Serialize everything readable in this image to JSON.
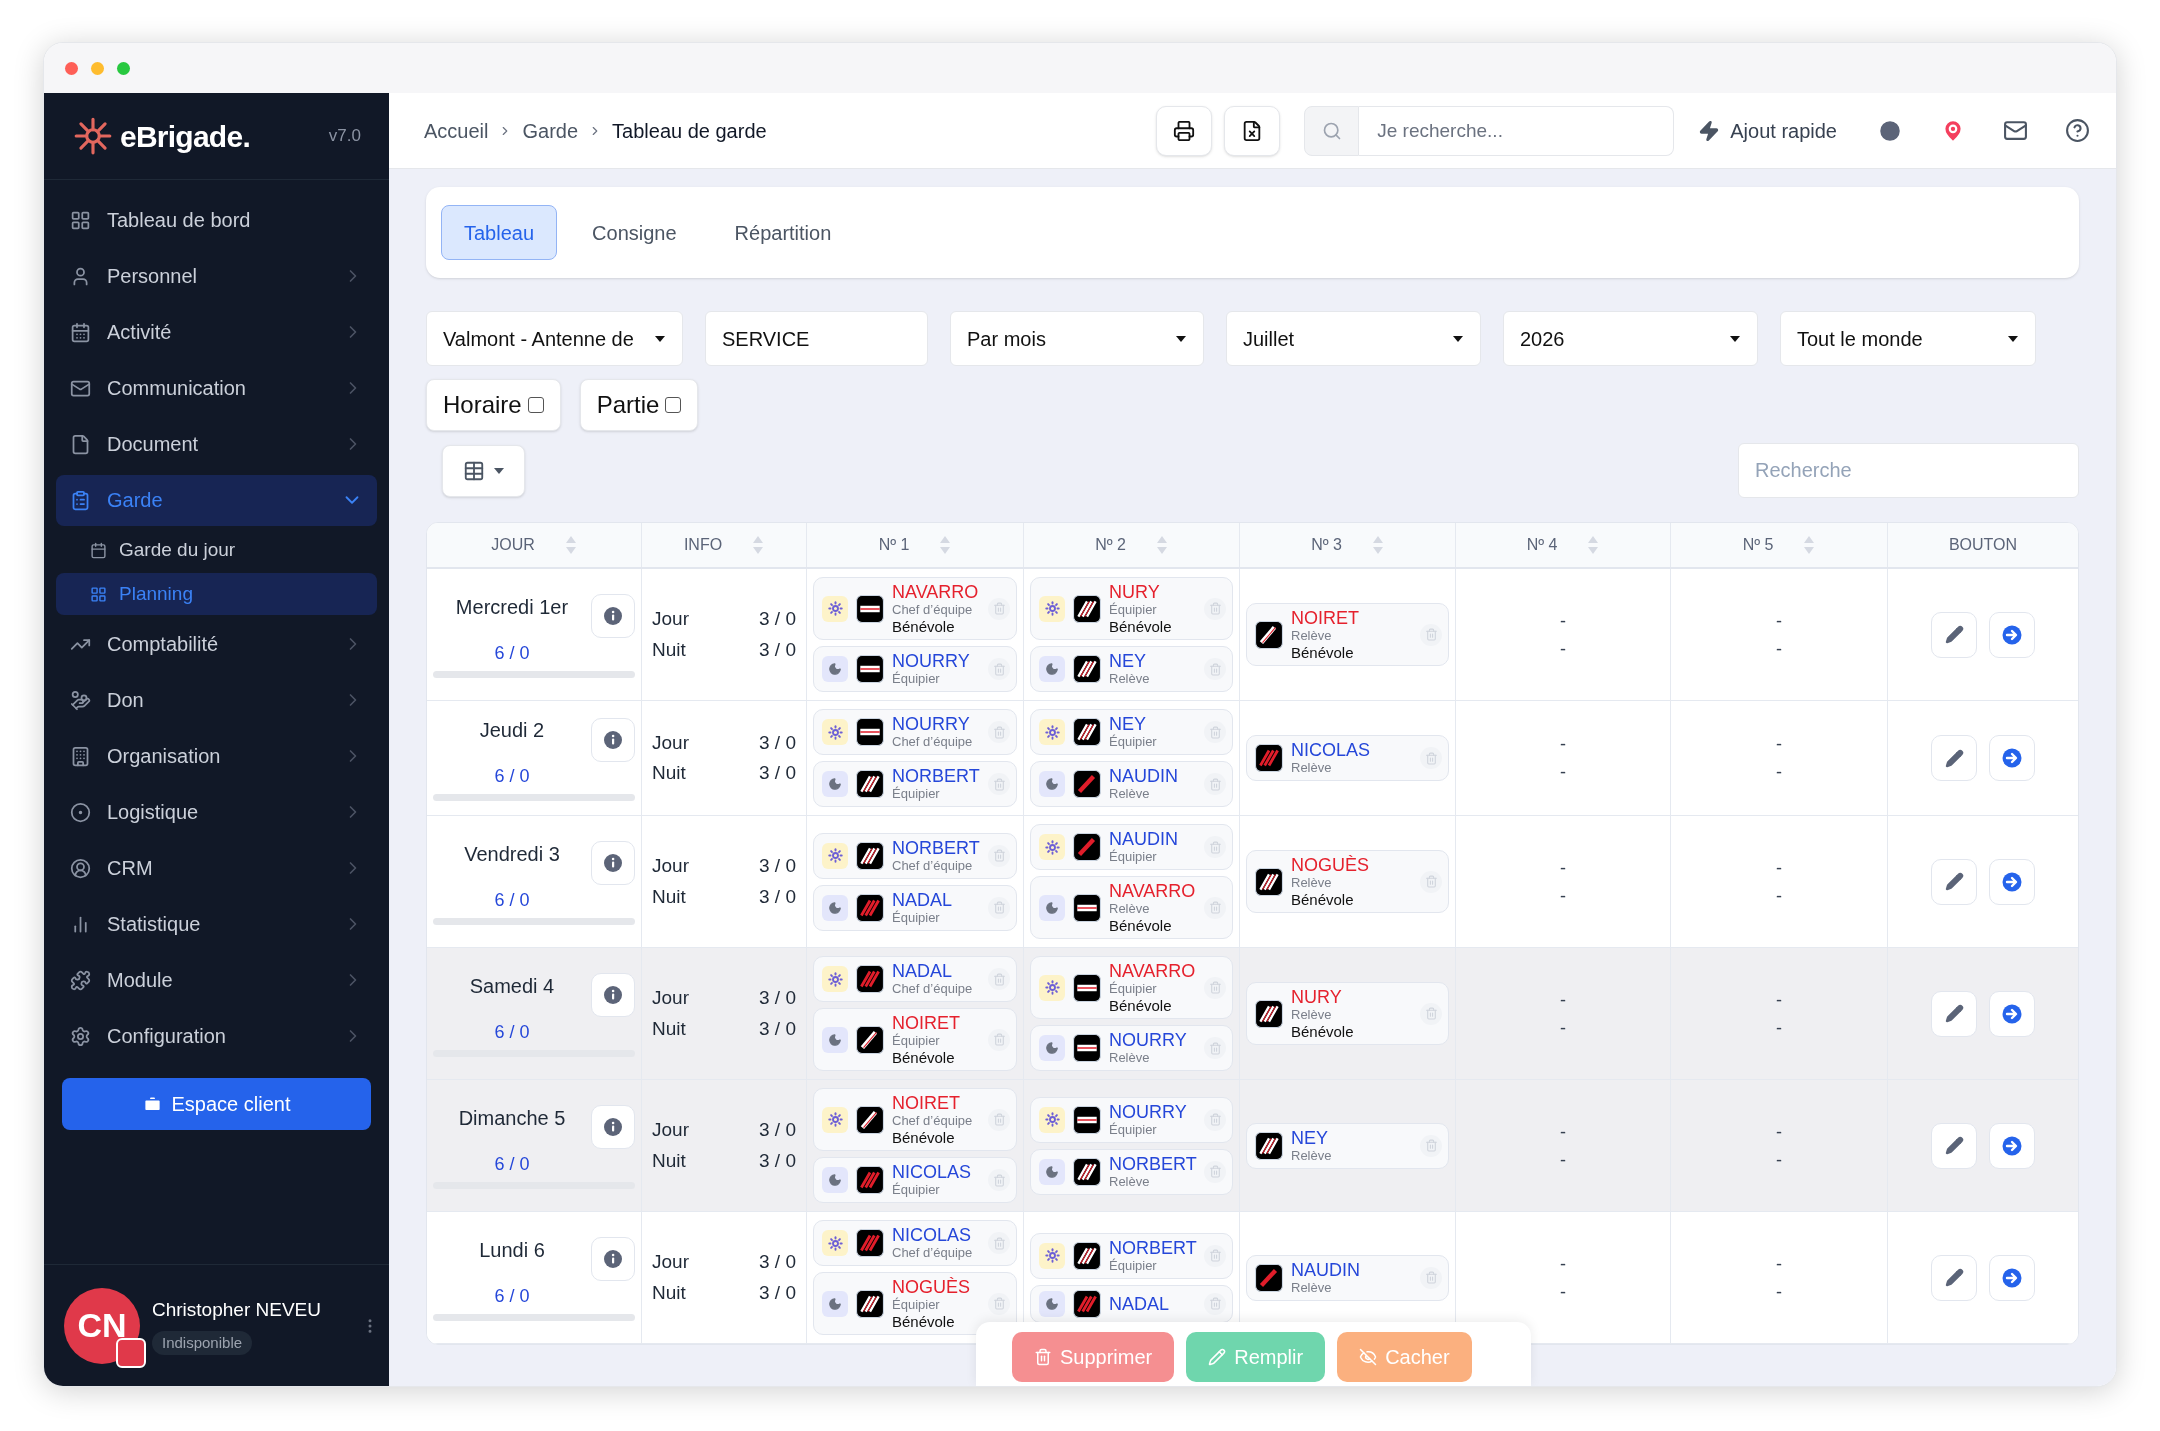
{
  "sidebar": {
    "logo": "eBrigade.",
    "version": "v7.0",
    "items": [
      {
        "label": "Tableau de bord",
        "selected": false
      },
      {
        "label": "Personnel",
        "selected": false,
        "expanded": false
      },
      {
        "label": "Activité",
        "selected": false,
        "expanded": false
      },
      {
        "label": "Communication",
        "selected": false,
        "expanded": false
      },
      {
        "label": "Document",
        "selected": false,
        "expanded": false
      },
      {
        "label": "Garde",
        "selected": true,
        "expanded": true,
        "children": [
          {
            "label": "Garde du jour",
            "selected": false
          },
          {
            "label": "Planning",
            "selected": true
          }
        ]
      },
      {
        "label": "Comptabilité",
        "selected": false,
        "expanded": false
      },
      {
        "label": "Don",
        "selected": false,
        "expanded": false
      },
      {
        "label": "Organisation",
        "selected": false,
        "expanded": false
      },
      {
        "label": "Logistique",
        "selected": false,
        "expanded": false
      },
      {
        "label": "CRM",
        "selected": false,
        "expanded": false
      },
      {
        "label": "Statistique",
        "selected": false,
        "expanded": false
      },
      {
        "label": "Module",
        "selected": false,
        "expanded": false
      },
      {
        "label": "Configuration",
        "selected": false,
        "expanded": false
      }
    ],
    "client_button": "Espace client",
    "user": {
      "initials": "CN",
      "name": "Christopher NEVEU",
      "status": "Indisponible"
    }
  },
  "header": {
    "breadcrumbs": [
      "Accueil",
      "Garde",
      "Tableau de garde"
    ],
    "search": {
      "placeholder": "Je recherche..."
    },
    "quick_add": "Ajout rapide"
  },
  "tabs": [
    {
      "label": "Tableau",
      "selected": true
    },
    {
      "label": "Consigne",
      "selected": false
    },
    {
      "label": "Répartition",
      "selected": false
    }
  ],
  "filters": [
    {
      "kind": "select",
      "value": "Valmont - Antenne de"
    },
    {
      "kind": "text",
      "value": "SERVICE"
    },
    {
      "kind": "select",
      "value": "Par mois"
    },
    {
      "kind": "select",
      "value": "Juillet"
    },
    {
      "kind": "select",
      "value": "2026"
    },
    {
      "kind": "select",
      "value": "Tout le monde"
    }
  ],
  "checkboxes": [
    {
      "label": "Horaire",
      "checked": false
    },
    {
      "label": "Partie",
      "checked": false
    }
  ],
  "table_search": {
    "placeholder": "Recherche"
  },
  "columns": [
    {
      "label": "JOUR",
      "sortable": true
    },
    {
      "label": "INFO",
      "sortable": true
    },
    {
      "label": "Nº 1",
      "sortable": true
    },
    {
      "label": "Nº 2",
      "sortable": true
    },
    {
      "label": "Nº 3",
      "sortable": true
    },
    {
      "label": "Nº 4",
      "sortable": true
    },
    {
      "label": "Nº 5",
      "sortable": true
    },
    {
      "label": "BOUTON",
      "sortable": false
    }
  ],
  "rows": [
    {
      "day": "Mercredi 1er",
      "count": "6 / 0",
      "weekend": false,
      "info": [
        {
          "label": "Jour",
          "value": "3 / 0"
        },
        {
          "label": "Nuit",
          "value": "3 / 0"
        }
      ],
      "n1": [
        {
          "night": false,
          "name": "NAVARRO",
          "color": "#e5212d",
          "kind": "band",
          "role": "Chef d’équipe",
          "status": "Bénévole"
        },
        {
          "night": true,
          "name": "NOURRY",
          "color": "#2547d9",
          "kind": "band",
          "role": "Équipier"
        }
      ],
      "n2": [
        {
          "night": false,
          "name": "NURY",
          "color": "#e5212d",
          "kind": "stripes",
          "role": "Équipier",
          "status": "Bénévole"
        },
        {
          "night": true,
          "name": "NEY",
          "color": "#2547d9",
          "kind": "stripes",
          "role": "Relève"
        }
      ],
      "n3": {
        "name": "NOIRET",
        "color": "#e5212d",
        "kind": "slash",
        "role": "Relève",
        "status": "Bénévole"
      },
      "n4": [
        "-",
        "-"
      ],
      "n5": [
        "-",
        "-"
      ]
    },
    {
      "day": "Jeudi 2",
      "count": "6 / 0",
      "weekend": false,
      "info": [
        {
          "label": "Jour",
          "value": "3 / 0"
        },
        {
          "label": "Nuit",
          "value": "3 / 0"
        }
      ],
      "n1": [
        {
          "night": false,
          "name": "NOURRY",
          "color": "#2547d9",
          "kind": "band",
          "role": "Chef d’équipe"
        },
        {
          "night": true,
          "name": "NORBERT",
          "color": "#2547d9",
          "kind": "stripes",
          "role": "Équipier"
        }
      ],
      "n2": [
        {
          "night": false,
          "name": "NEY",
          "color": "#2547d9",
          "kind": "stripes",
          "role": "Équipier"
        },
        {
          "night": true,
          "name": "NAUDIN",
          "color": "#2547d9",
          "kind": "redslash",
          "role": "Relève"
        }
      ],
      "n3": {
        "name": "NICOLAS",
        "color": "#2547d9",
        "kind": "redstripes",
        "role": "Relève"
      },
      "n4": [
        "-",
        "-"
      ],
      "n5": [
        "-",
        "-"
      ]
    },
    {
      "day": "Vendredi 3",
      "count": "6 / 0",
      "weekend": false,
      "info": [
        {
          "label": "Jour",
          "value": "3 / 0"
        },
        {
          "label": "Nuit",
          "value": "3 / 0"
        }
      ],
      "n1": [
        {
          "night": false,
          "name": "NORBERT",
          "color": "#2547d9",
          "kind": "stripes",
          "role": "Chef d’équipe"
        },
        {
          "night": true,
          "name": "NADAL",
          "color": "#2547d9",
          "kind": "redstripes",
          "role": "Équipier"
        }
      ],
      "n2": [
        {
          "night": false,
          "name": "NAUDIN",
          "color": "#2547d9",
          "kind": "redslash",
          "role": "Équipier"
        },
        {
          "night": true,
          "name": "NAVARRO",
          "color": "#e5212d",
          "kind": "band",
          "role": "Relève",
          "status": "Bénévole"
        }
      ],
      "n3": {
        "name": "NOGUÈS",
        "color": "#e5212d",
        "kind": "stripes",
        "role": "Relève",
        "status": "Bénévole"
      },
      "n4": [
        "-",
        "-"
      ],
      "n5": [
        "-",
        "-"
      ]
    },
    {
      "day": "Samedi 4",
      "count": "6 / 0",
      "weekend": true,
      "info": [
        {
          "label": "Jour",
          "value": "3 / 0"
        },
        {
          "label": "Nuit",
          "value": "3 / 0"
        }
      ],
      "n1": [
        {
          "night": false,
          "name": "NADAL",
          "color": "#2547d9",
          "kind": "redstripes",
          "role": "Chef d’équipe"
        },
        {
          "night": true,
          "name": "NOIRET",
          "color": "#e5212d",
          "kind": "slash",
          "role": "Équipier",
          "status": "Bénévole"
        }
      ],
      "n2": [
        {
          "night": false,
          "name": "NAVARRO",
          "color": "#e5212d",
          "kind": "band",
          "role": "Équipier",
          "status": "Bénévole"
        },
        {
          "night": true,
          "name": "NOURRY",
          "color": "#2547d9",
          "kind": "band",
          "role": "Relève"
        }
      ],
      "n3": {
        "name": "NURY",
        "color": "#e5212d",
        "kind": "stripes",
        "role": "Relève",
        "status": "Bénévole"
      },
      "n4": [
        "-",
        "-"
      ],
      "n5": [
        "-",
        "-"
      ]
    },
    {
      "day": "Dimanche 5",
      "count": "6 / 0",
      "weekend": true,
      "info": [
        {
          "label": "Jour",
          "value": "3 / 0"
        },
        {
          "label": "Nuit",
          "value": "3 / 0"
        }
      ],
      "n1": [
        {
          "night": false,
          "name": "NOIRET",
          "color": "#e5212d",
          "kind": "slash",
          "role": "Chef d’équipe",
          "status": "Bénévole"
        },
        {
          "night": true,
          "name": "NICOLAS",
          "color": "#2547d9",
          "kind": "redstripes",
          "role": "Équipier"
        }
      ],
      "n2": [
        {
          "night": false,
          "name": "NOURRY",
          "color": "#2547d9",
          "kind": "band",
          "role": "Équipier"
        },
        {
          "night": true,
          "name": "NORBERT",
          "color": "#2547d9",
          "kind": "stripes",
          "role": "Relève"
        }
      ],
      "n3": {
        "name": "NEY",
        "color": "#2547d9",
        "kind": "stripes",
        "role": "Relève"
      },
      "n4": [
        "-",
        "-"
      ],
      "n5": [
        "-",
        "-"
      ]
    },
    {
      "day": "Lundi 6",
      "count": "6 / 0",
      "weekend": false,
      "info": [
        {
          "label": "Jour",
          "value": "3 / 0"
        },
        {
          "label": "Nuit",
          "value": "3 / 0"
        }
      ],
      "n1": [
        {
          "night": false,
          "name": "NICOLAS",
          "color": "#2547d9",
          "kind": "redstripes",
          "role": "Chef d’équipe"
        },
        {
          "night": true,
          "name": "NOGUÈS",
          "color": "#e5212d",
          "kind": "stripes",
          "role": "Équipier",
          "status": "Bénévole"
        }
      ],
      "n2": [
        {
          "night": false,
          "name": "NORBERT",
          "color": "#2547d9",
          "kind": "stripes",
          "role": "Équipier"
        },
        {
          "night": true,
          "name": "NADAL",
          "color": "#2547d9",
          "kind": "redstripes"
        }
      ],
      "n3": {
        "name": "NAUDIN",
        "color": "#2547d9",
        "kind": "redslash",
        "role": "Relève"
      },
      "n4": [
        "-",
        "-"
      ],
      "n5": [
        "-",
        "-"
      ]
    }
  ],
  "actions": [
    {
      "kind": "danger",
      "label": "Supprimer"
    },
    {
      "kind": "success",
      "label": "Remplir"
    },
    {
      "kind": "warning",
      "label": "Cacher"
    }
  ]
}
